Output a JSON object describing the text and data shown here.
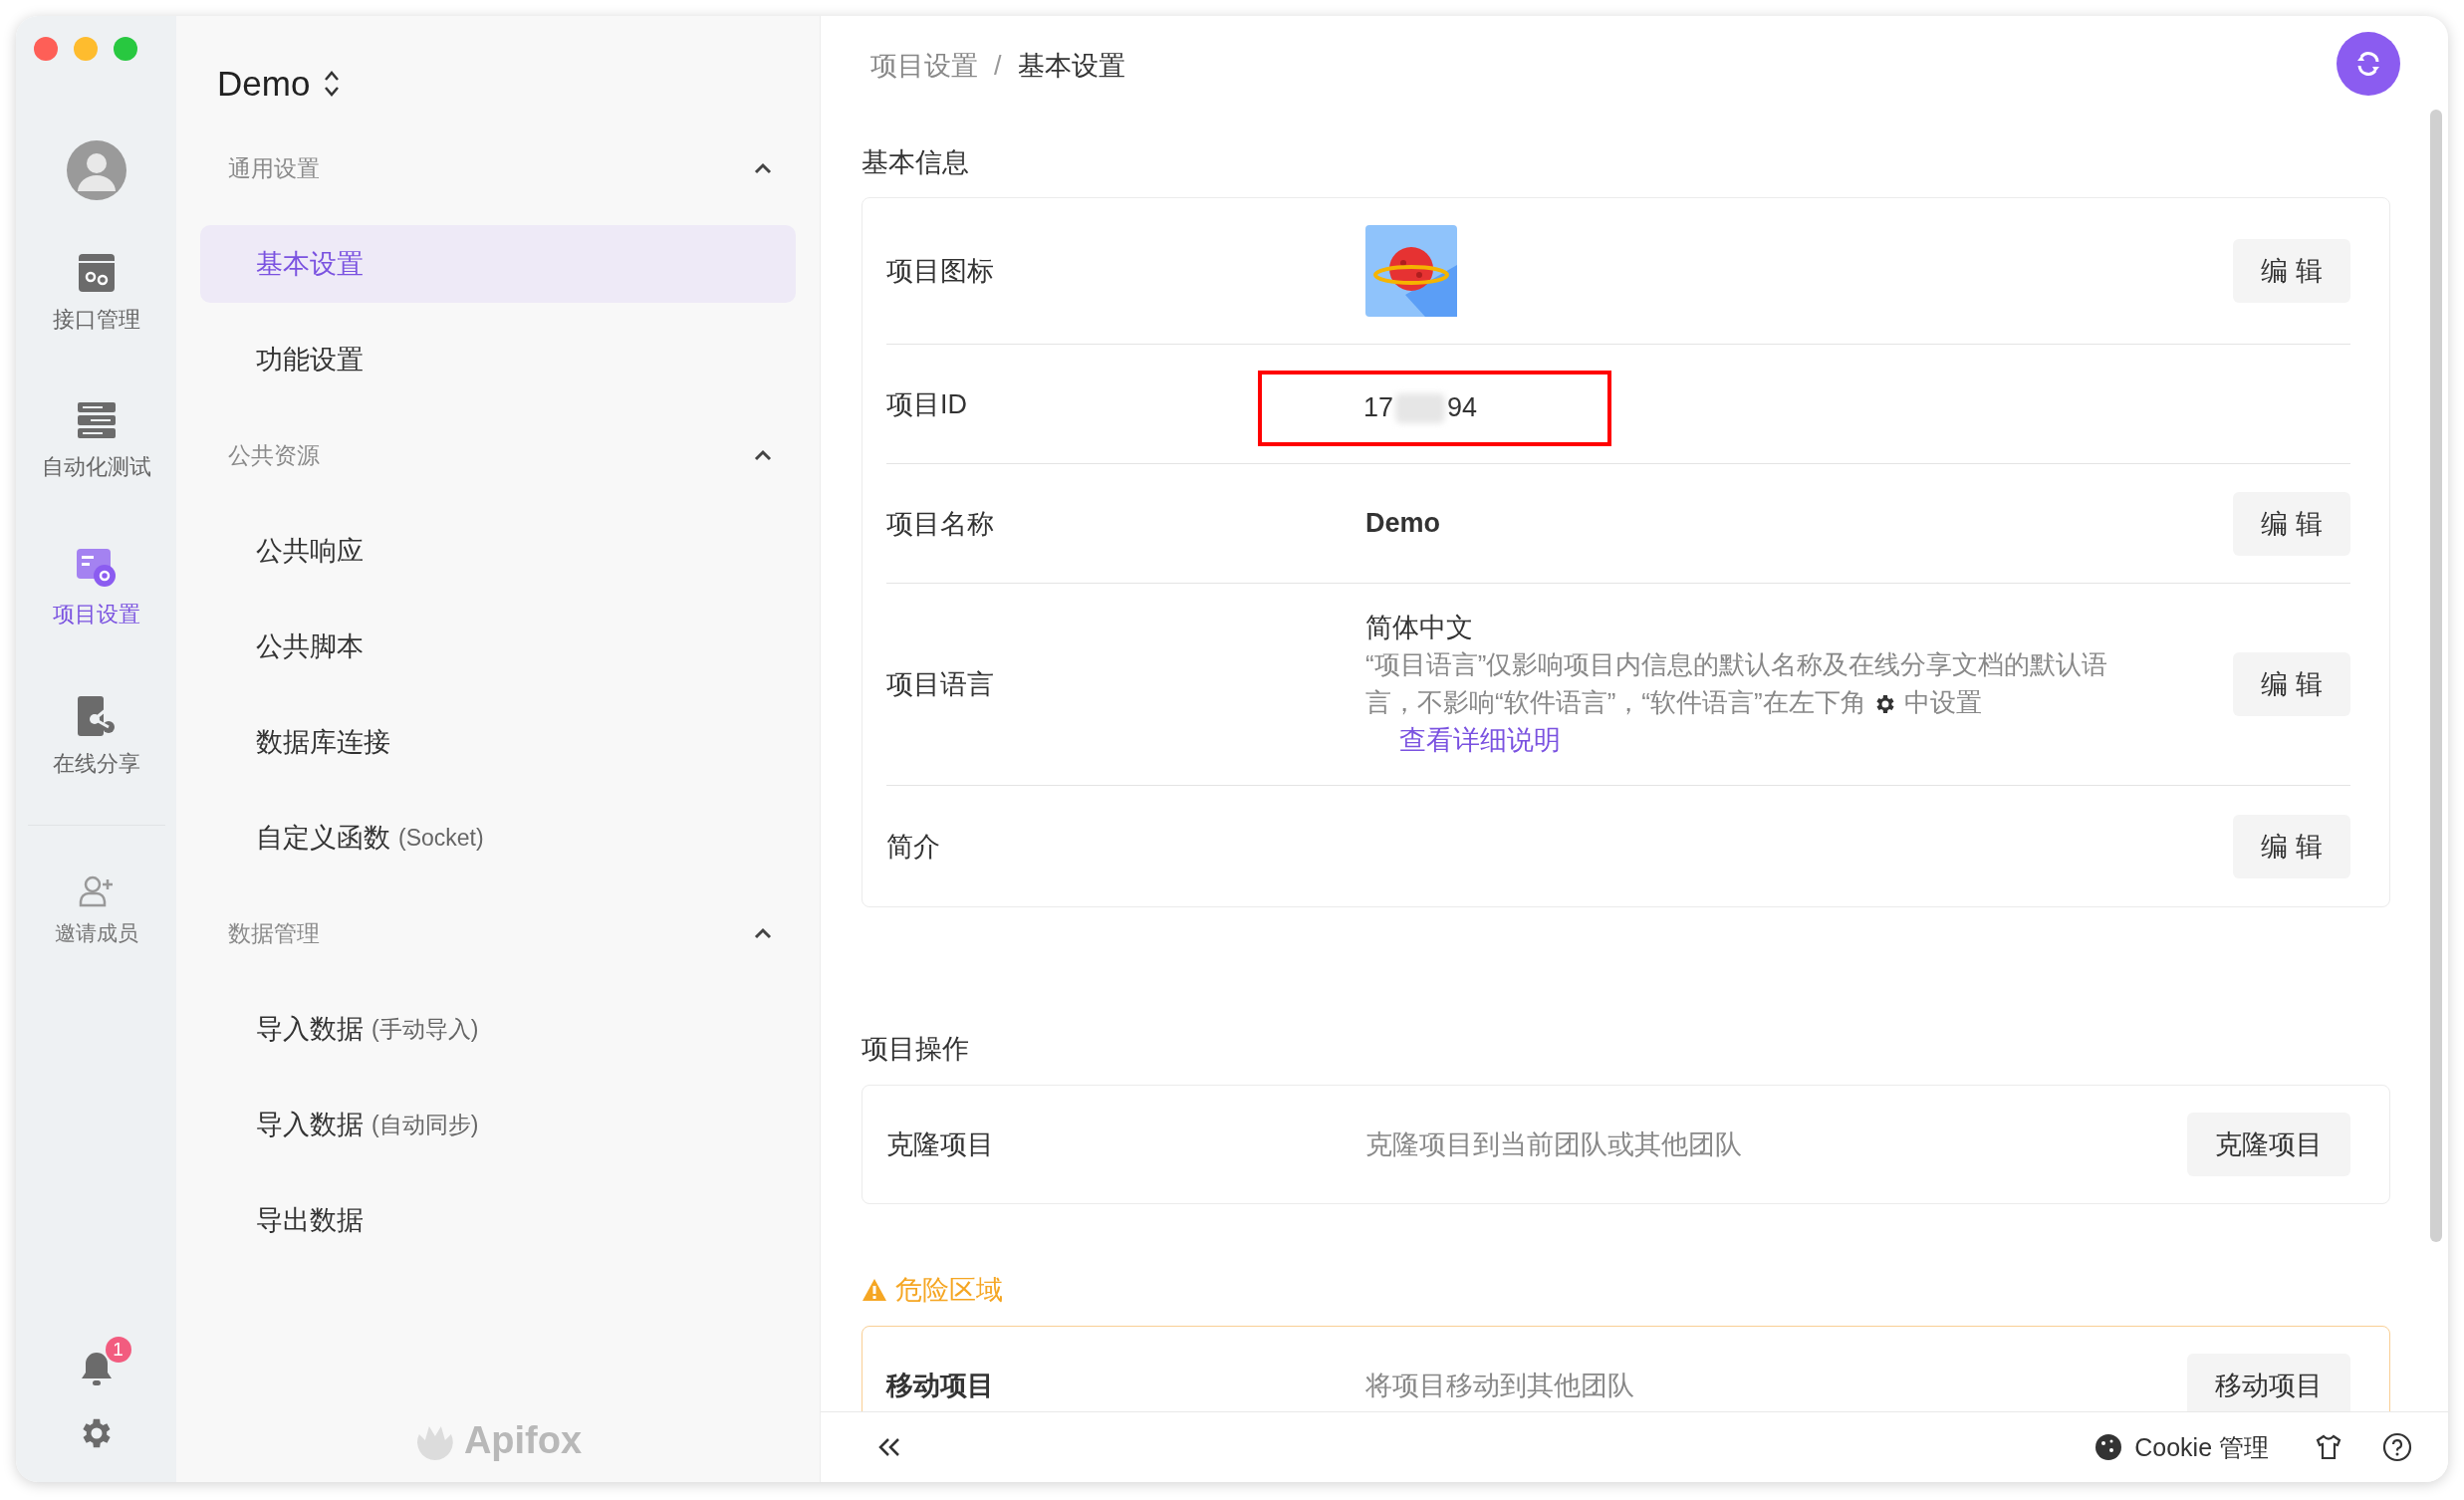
{
  "rail": {
    "items": [
      {
        "label": "接口管理",
        "selected": false
      },
      {
        "label": "自动化测试",
        "selected": false
      },
      {
        "label": "项目设置",
        "selected": true
      },
      {
        "label": "在线分享",
        "selected": false
      }
    ],
    "invite": "邀请成员",
    "notification_count": "1"
  },
  "sidebar": {
    "project": "Demo",
    "groups": [
      {
        "title": "通用设置",
        "expanded": true,
        "items": [
          {
            "label": "基本设置",
            "selected": true
          },
          {
            "label": "功能设置",
            "selected": false
          }
        ]
      },
      {
        "title": "公共资源",
        "expanded": true,
        "items": [
          {
            "label": "公共响应",
            "selected": false
          },
          {
            "label": "公共脚本",
            "selected": false
          },
          {
            "label": "数据库连接",
            "selected": false
          },
          {
            "label": "自定义函数",
            "suffix": "(Socket)",
            "selected": false
          }
        ]
      },
      {
        "title": "数据管理",
        "expanded": true,
        "items": [
          {
            "label": "导入数据",
            "suffix": "(手动导入)",
            "selected": false
          },
          {
            "label": "导入数据",
            "suffix": "(自动同步)",
            "selected": false
          },
          {
            "label": "导出数据",
            "selected": false
          }
        ]
      }
    ],
    "logo": "Apifox"
  },
  "breadcrumb": [
    "项目设置",
    "基本设置"
  ],
  "breadcrumb_separator": "/",
  "basic_info": {
    "title": "基本信息",
    "rows": [
      {
        "kind": "icon",
        "label": "项目图标",
        "action": "编 辑"
      },
      {
        "kind": "id",
        "label": "项目ID",
        "id_start": "17",
        "id_end": "94"
      },
      {
        "kind": "text",
        "label": "项目名称",
        "value": "Demo",
        "action": "编 辑"
      },
      {
        "kind": "language",
        "label": "项目语言",
        "value": "简体中文",
        "note_before": "“项目语言”仅影响项目内信息的默认名称及在线分享文档的默认语言，不影响“软件语言”，“软件语言”在左下角",
        "note_after": "中设置",
        "link": "查看详细说明",
        "action": "编 辑"
      },
      {
        "kind": "empty",
        "label": "简介",
        "action": "编 辑"
      }
    ]
  },
  "operations": {
    "title": "项目操作",
    "rows": [
      {
        "label": "克隆项目",
        "description": "克隆项目到当前团队或其他团队",
        "action": "克隆项目"
      }
    ]
  },
  "danger": {
    "title": "危险区域",
    "rows": [
      {
        "label": "移动项目",
        "description": "将项目移动到其他团队",
        "action": "移动项目"
      }
    ]
  },
  "footer": {
    "cookie": "Cookie 管理"
  }
}
